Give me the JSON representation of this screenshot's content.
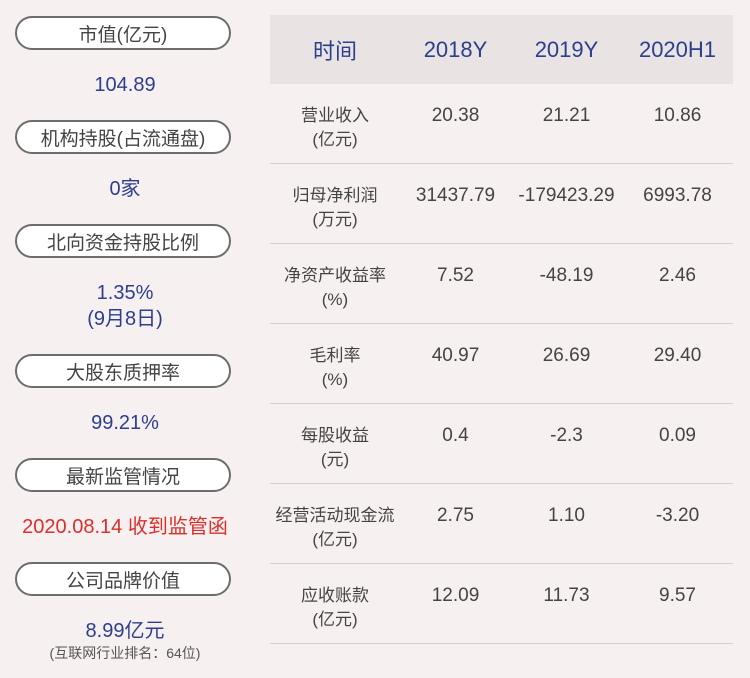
{
  "left_panel": {
    "items": [
      {
        "title": "市值(亿元)",
        "value": "104.89"
      },
      {
        "title": "机构持股(占流通盘)",
        "value": "0家"
      },
      {
        "title": "北向资金持股比例",
        "value": "1.35%",
        "value2": "(9月8日)"
      },
      {
        "title": "大股东质押率",
        "value": "99.21%"
      },
      {
        "title": "最新监管情况",
        "value": "2020.08.14 收到监管函"
      },
      {
        "title": "公司品牌价值",
        "value": "8.99亿元",
        "note": "(互联网行业排名：64位)"
      }
    ]
  },
  "table": {
    "headers": [
      "时间",
      "2018Y",
      "2019Y",
      "2020H1"
    ],
    "rows": [
      {
        "label1": "营业收入",
        "label2": "(亿元)",
        "values": [
          "20.38",
          "21.21",
          "10.86"
        ]
      },
      {
        "label1": "归母净利润",
        "label2": "(万元)",
        "values": [
          "31437.79",
          "-179423.29",
          "6993.78"
        ]
      },
      {
        "label1": "净资产收益率",
        "label2": "(%)",
        "values": [
          "7.52",
          "-48.19",
          "2.46"
        ]
      },
      {
        "label1": "毛利率",
        "label2": "(%)",
        "values": [
          "40.97",
          "26.69",
          "29.40"
        ]
      },
      {
        "label1": "每股收益",
        "label2": "(元)",
        "values": [
          "0.4",
          "-2.3",
          "0.09"
        ]
      },
      {
        "label1": "经营活动现金流",
        "label2": "(亿元)",
        "values": [
          "2.75",
          "1.10",
          "-3.20"
        ]
      },
      {
        "label1": "应收账款",
        "label2": "(亿元)",
        "values": [
          "12.09",
          "11.73",
          "9.57"
        ]
      }
    ]
  },
  "colors": {
    "background": "#f7f0f0",
    "value_blue": "#2c3f8c",
    "alert_red": "#d9302b",
    "header_bg": "#e9e3e3"
  }
}
